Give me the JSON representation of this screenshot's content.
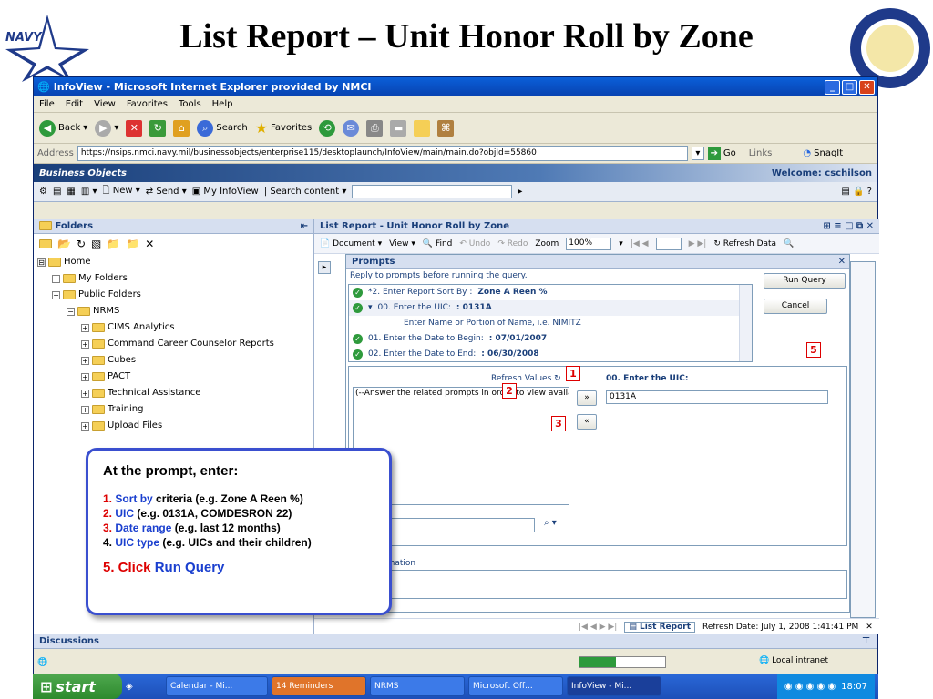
{
  "slide": {
    "title": "List Report – Unit Honor Roll by Zone",
    "navy_logo_text": "NAVY"
  },
  "window": {
    "title": "InfoView - Microsoft Internet Explorer provided by NMCI"
  },
  "menu": [
    "File",
    "Edit",
    "View",
    "Favorites",
    "Tools",
    "Help"
  ],
  "ie_toolbar": {
    "back": "Back",
    "search": "Search",
    "favorites": "Favorites"
  },
  "address": {
    "label": "Address",
    "url": "https://nsips.nmci.navy.mil/businessobjects/enterprise115/desktoplaunch/InfoView/main/main.do?objId=55860",
    "go": "Go",
    "links": "Links",
    "snagit": "SnagIt"
  },
  "bo": {
    "logo": "Business Objects",
    "welcome": "Welcome: cschilson",
    "toolbar": {
      "new": "New",
      "send": "Send",
      "my_infoview": "My InfoView",
      "search_content": "Search content"
    }
  },
  "folders": {
    "header": "Folders",
    "tree": [
      {
        "label": "Home",
        "indent": 0,
        "pm": "⊟"
      },
      {
        "label": "My Folders",
        "indent": 1,
        "pm": "+"
      },
      {
        "label": "Public Folders",
        "indent": 1,
        "pm": "−"
      },
      {
        "label": "NRMS",
        "indent": 2,
        "pm": "−"
      },
      {
        "label": "CIMS Analytics",
        "indent": 3,
        "pm": "+"
      },
      {
        "label": "Command Career Counselor Reports",
        "indent": 3,
        "pm": "+"
      },
      {
        "label": "Cubes",
        "indent": 3,
        "pm": "+"
      },
      {
        "label": "PACT",
        "indent": 3,
        "pm": "+"
      },
      {
        "label": "Technical Assistance",
        "indent": 3,
        "pm": "+"
      },
      {
        "label": "Training",
        "indent": 3,
        "pm": "+"
      },
      {
        "label": "Upload Files",
        "indent": 3,
        "pm": "+"
      }
    ]
  },
  "report": {
    "header": "List Report - Unit Honor Roll by Zone",
    "toolbar": {
      "document": "Document",
      "view": "View",
      "find": "Find",
      "undo": "Undo",
      "redo": "Redo",
      "zoom_label": "Zoom",
      "zoom_value": "100%",
      "refresh": "Refresh Data"
    },
    "tab": "List Report",
    "refresh_date": "Refresh Date: July 1, 2008 1:41:41 PM"
  },
  "prompts": {
    "header": "Prompts",
    "instructions": "Reply to prompts before running the query.",
    "rows": [
      {
        "text": "*2. Enter Report Sort By :",
        "value": " Zone A Reen %"
      },
      {
        "text": "00. Enter the UIC:",
        "value": " : 0131A"
      },
      {
        "text": "Enter Name or Portion of Name, i.e. NIMITZ",
        "value": ""
      },
      {
        "text": "01. Enter the Date to Begin:",
        "value": " : 07/01/2007"
      },
      {
        "text": "02. Enter the Date to End:",
        "value": " : 06/30/2008"
      }
    ],
    "run_query": "Run Query",
    "cancel": "Cancel",
    "refresh_values": "Refresh Values",
    "uic_label": "00. Enter the UIC:",
    "uic_value": "0131A",
    "list_placeholder": "(--Answer the related prompts in order to view availab",
    "add_btn": "»",
    "remove_btn": "«",
    "info_label": "Information"
  },
  "markers": [
    "1",
    "2",
    "3",
    "5"
  ],
  "callout": {
    "heading": "At the prompt, enter:",
    "items": [
      {
        "num": "1.",
        "key": "Sort by",
        "rest": " criteria (e.g. Zone A Reen %)"
      },
      {
        "num": "2.",
        "key": "UIC",
        "rest": " (e.g. 0131A, COMDESRON 22)"
      },
      {
        "num": "3.",
        "key": "Date range",
        "rest": " (e.g. last 12 months)"
      },
      {
        "num": "4.",
        "key": "UIC type",
        "rest": " (e.g. UICs and their children)"
      }
    ],
    "step5_prefix": "5. Click ",
    "step5_action": "Run Query"
  },
  "discussions": "Discussions",
  "status": {
    "zone": "Local intranet"
  },
  "taskbar": {
    "start": "start",
    "tasks": [
      "Calendar - Mi...",
      "14 Reminders",
      "NRMS",
      "Microsoft Off...",
      "InfoView - Mi..."
    ],
    "clock": "18:07"
  }
}
